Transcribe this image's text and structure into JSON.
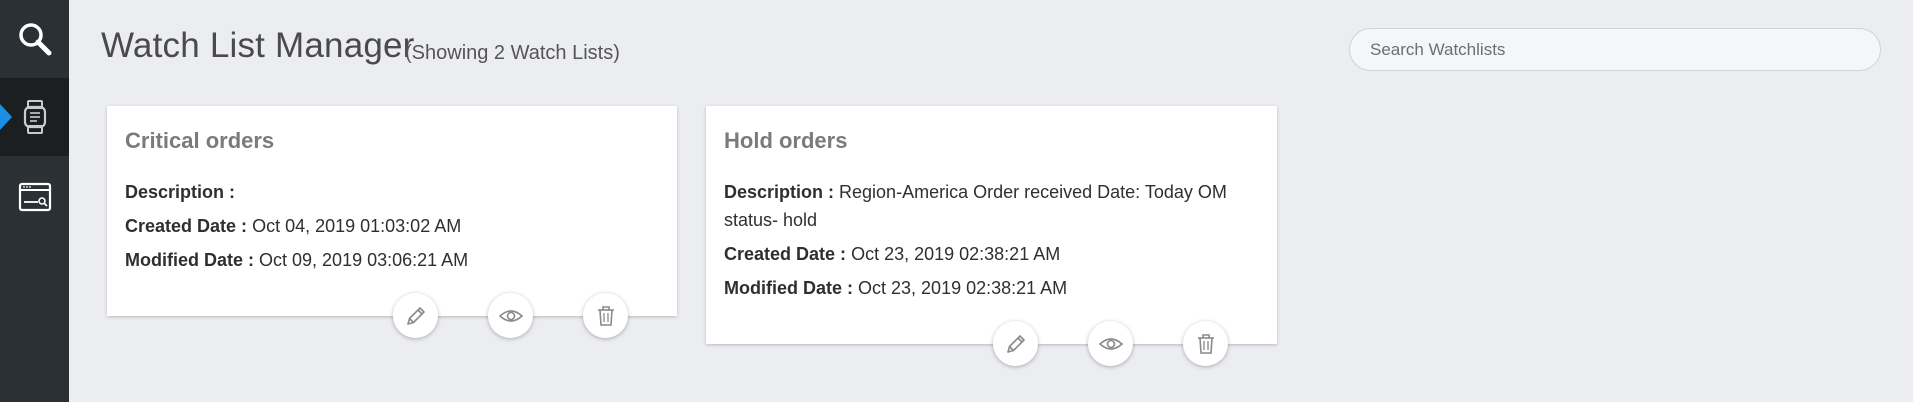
{
  "page": {
    "title": "Watch List Manager",
    "count_text": "(Showing 2 Watch Lists)"
  },
  "sidebar": {
    "items": [
      {
        "icon": "search-icon"
      },
      {
        "icon": "watch-icon",
        "active": true
      },
      {
        "icon": "browser-window-icon"
      }
    ]
  },
  "search": {
    "placeholder": "Search Watchlists",
    "value": ""
  },
  "cards": [
    {
      "title": "Critical orders",
      "description_label": "Description :",
      "description": "",
      "created_label": "Created Date :",
      "created": "Oct 04, 2019 01:03:02 AM",
      "modified_label": "Modified Date :",
      "modified": "Oct 09, 2019 03:06:21 AM"
    },
    {
      "title": "Hold orders",
      "description_label": "Description :",
      "description": "Region-America Order received Date: Today OM status- hold",
      "created_label": "Created Date :",
      "created": "Oct 23, 2019 02:38:21 AM",
      "modified_label": "Modified Date :",
      "modified": "Oct 23, 2019 02:38:21 AM"
    }
  ],
  "colors": {
    "sidebar_bg": "#2b3034",
    "sidebar_active_bg": "#1b1f22",
    "active_indicator": "#1a8fe3",
    "page_bg": "#ecedf1"
  }
}
